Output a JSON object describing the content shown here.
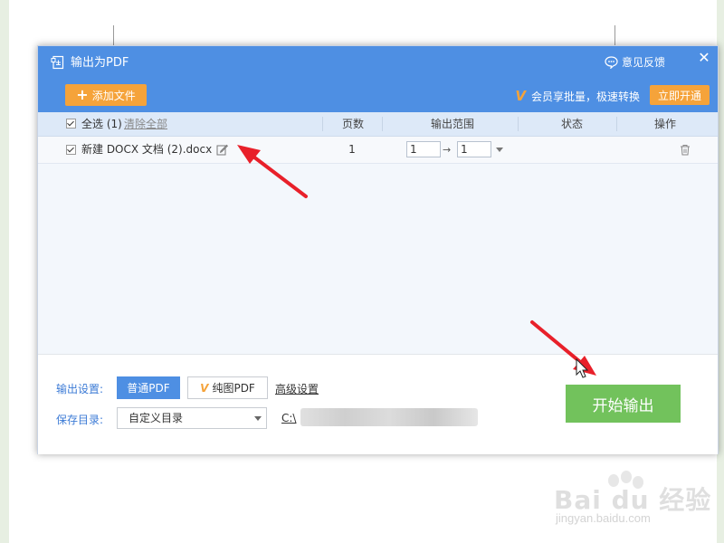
{
  "dialog": {
    "title": "输出为PDF",
    "feedback_label": "意见反馈",
    "close_glyph": "✕"
  },
  "toolbar": {
    "add_file_label": "添加文件",
    "vip_notice": "会员享批量，极速转换",
    "vip_button_label": "立即开通"
  },
  "table": {
    "select_all_label": "全选 (1)",
    "clear_all_label": "清除全部",
    "columns": {
      "pages": "页数",
      "range": "输出范围",
      "status": "状态",
      "actions": "操作"
    },
    "rows": [
      {
        "checked": true,
        "filename": "新建 DOCX 文档 (2).docx",
        "pages": "1",
        "range_from": "1",
        "range_to": "1",
        "status": ""
      }
    ]
  },
  "footer": {
    "output_settings_label": "输出设置:",
    "normal_pdf_label": "普通PDF",
    "image_pdf_label": "纯图PDF",
    "advanced_settings_label": "高级设置",
    "save_dir_label": "保存目录:",
    "save_dir_selected": "自定义目录",
    "save_path_prefix": "C:\\",
    "start_button_label": "开始输出"
  },
  "watermark": {
    "brand": "Bai du 经验",
    "url": "jingyan.baidu.com"
  },
  "colors": {
    "titlebar": "#4e8fe3",
    "orange": "#f5a33a",
    "start_green": "#72c25c",
    "link_blue": "#3c7bd6",
    "arrow_red": "#e8202a"
  }
}
